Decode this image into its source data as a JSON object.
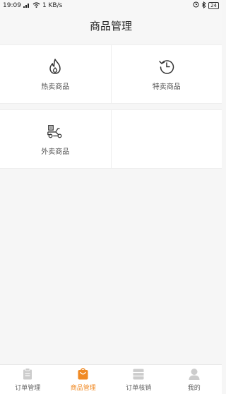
{
  "status": {
    "time": "19:09",
    "speed": "1 KB/s",
    "battery": "24"
  },
  "header": {
    "title": "商品管理"
  },
  "grid": [
    {
      "label": "热卖商品",
      "icon": "flame-icon"
    },
    {
      "label": "特卖商品",
      "icon": "clock-refresh-icon"
    },
    {
      "label": "外卖商品",
      "icon": "scooter-icon"
    }
  ],
  "tabs": [
    {
      "label": "订单管理",
      "icon": "clipboard-icon"
    },
    {
      "label": "商品管理",
      "icon": "shopping-bag-icon",
      "active": true
    },
    {
      "label": "订单核销",
      "icon": "grid-list-icon"
    },
    {
      "label": "我的",
      "icon": "user-icon"
    }
  ],
  "colors": {
    "accent": "#f08a24",
    "inactive": "#cccccc"
  }
}
